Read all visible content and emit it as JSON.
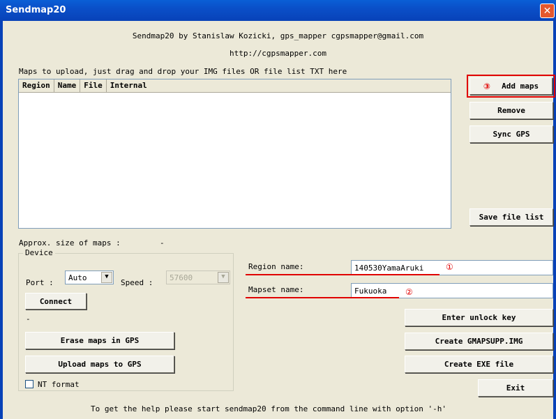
{
  "window": {
    "title": "Sendmap20",
    "close_glyph": "✕"
  },
  "header": {
    "credits": "Sendmap20 by Stanislaw Kozicki, gps_mapper cgpsmapper@gmail.com",
    "url": "http://cgpsmapper.com"
  },
  "maps_list": {
    "label": "Maps to upload, just drag and drop your IMG files OR file list TXT here",
    "columns": [
      "Region",
      "Name",
      "File",
      "Internal"
    ]
  },
  "right_buttons": {
    "add_maps": "Add maps",
    "add_maps_marker": "③",
    "remove": "Remove",
    "sync_gps": "Sync GPS",
    "save_file_list": "Save file list"
  },
  "approx_size": {
    "label": "Approx. size of maps :",
    "value": "-"
  },
  "device": {
    "group_label": "Device",
    "port_label": "Port :",
    "port_value": "Auto",
    "speed_label": "Speed :",
    "speed_value": "57600",
    "connect": "Connect",
    "status": "-",
    "erase": "Erase maps in GPS",
    "upload": "Upload maps to GPS",
    "nt_format": "NT format"
  },
  "region": {
    "label": "Region name:",
    "value": "140530YamaAruki",
    "marker": "①"
  },
  "mapset": {
    "label": "Mapset name:",
    "value": "Fukuoka",
    "marker": "②"
  },
  "actions": {
    "unlock": "Enter unlock key",
    "gmapsupp": "Create GMAPSUPP.IMG",
    "exe": "Create EXE file",
    "exit": "Exit"
  },
  "footer": "To get the help please start sendmap20 from the command line with option '-h'",
  "colors": {
    "title_bar": "#0a4fc8",
    "highlight": "#e00000",
    "face": "#ece9d8"
  }
}
